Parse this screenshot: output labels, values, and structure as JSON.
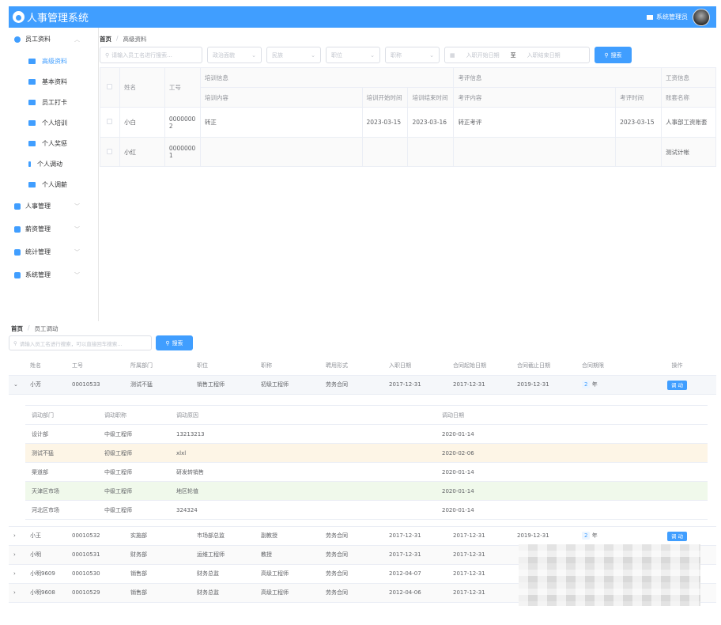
{
  "app": {
    "title": "人事管理系统",
    "user": "系统管理员"
  },
  "sidebar": {
    "group1": "员工资料",
    "subs": [
      "高级资料",
      "基本资料",
      "员工打卡",
      "个人培训",
      "个人奖惩",
      "个人调动",
      "个人调薪"
    ],
    "groups": [
      "人事管理",
      "薪资管理",
      "统计管理",
      "系统管理"
    ]
  },
  "top": {
    "crumb_home": "首页",
    "crumb_cur": "高级资料",
    "search_ph": "请输入员工名进行搜索...",
    "filters": [
      "政治面貌",
      "民族",
      "职位",
      "职称"
    ],
    "date_start": "入职开始日期",
    "date_to": "至",
    "date_end": "入职结束日期",
    "search_btn": "搜索",
    "headers": {
      "name": "姓名",
      "workid": "工号",
      "train": "培训信息",
      "train_content": "培训内容",
      "train_start": "培训开始时间",
      "train_end": "培训结束时间",
      "appraise": "考评信息",
      "appraise_content": "考评内容",
      "appraise_time": "考评时间",
      "salary": "工资信息",
      "account": "账套名称"
    },
    "rows": [
      {
        "name": "小白",
        "workid": "00000002",
        "train_content": "转正",
        "train_start": "2023-03-15",
        "train_end": "2023-03-16",
        "appraise_content": "转正考评",
        "appraise_time": "2023-03-15",
        "account": "人事部工资账套"
      },
      {
        "name": "小红",
        "workid": "00000001",
        "train_content": "",
        "train_start": "",
        "train_end": "",
        "appraise_content": "",
        "appraise_time": "",
        "account": "测试计帐"
      }
    ]
  },
  "bottom": {
    "crumb_home": "首页",
    "crumb_cur": "员工调动",
    "search_ph": "请输入员工名进行搜索，可以直接回车搜索...",
    "search_btn": "搜索",
    "headers": [
      "姓名",
      "工号",
      "所属部门",
      "职位",
      "职称",
      "聘用形式",
      "入职日期",
      "合同起始日期",
      "合同截止日期",
      "合同期限",
      "操作"
    ],
    "expanded": {
      "name": "小芳",
      "workid": "00010533",
      "dept": "测试不猛",
      "pos": "销售工程师",
      "title": "初级工程师",
      "form": "劳务合同",
      "join": "2017-12-31",
      "cstart": "2017-12-31",
      "cend": "2019-12-31",
      "years": "2",
      "unit": "年",
      "op": "调 动"
    },
    "detail_headers": [
      "调动部门",
      "调动职称",
      "调动原因",
      "调动日期"
    ],
    "details": [
      [
        "设计部",
        "中级工程师",
        "13213213",
        "2020-01-14"
      ],
      [
        "测试不猛",
        "初级工程师",
        "xlxl",
        "2020-02-06"
      ],
      [
        "渠道部",
        "中级工程师",
        "研发转销售",
        "2020-01-14"
      ],
      [
        "天津区市场",
        "中级工程师",
        "地区轮值",
        "2020-01-14"
      ],
      [
        "河北区市场",
        "中级工程师",
        "324324",
        "2020-01-14"
      ]
    ],
    "rows": [
      {
        "name": "小王",
        "workid": "00010532",
        "dept": "实施部",
        "pos": "市场部总监",
        "title": "副教授",
        "form": "劳务合同",
        "join": "2017-12-31",
        "cstart": "2017-12-31",
        "cend": "2019-12-31",
        "years": "2",
        "unit": "年",
        "op": "调 动"
      },
      {
        "name": "小明",
        "workid": "00010531",
        "dept": "财务部",
        "pos": "运维工程师",
        "title": "教授",
        "form": "劳务合同",
        "join": "2017-12-31",
        "cstart": "2017-12-31"
      },
      {
        "name": "小明9609",
        "workid": "00010530",
        "dept": "销售部",
        "pos": "财务总监",
        "title": "高级工程师",
        "form": "劳务合同",
        "join": "2012-04-07",
        "cstart": "2017-12-31"
      },
      {
        "name": "小明9608",
        "workid": "00010529",
        "dept": "销售部",
        "pos": "财务总监",
        "title": "高级工程师",
        "form": "劳务合同",
        "join": "2012-04-06",
        "cstart": "2017-12-31"
      }
    ]
  },
  "colors": {
    "primary": "#409eff",
    "row_warn": "#fdf5e6",
    "row_ok": "#f0f9eb"
  }
}
